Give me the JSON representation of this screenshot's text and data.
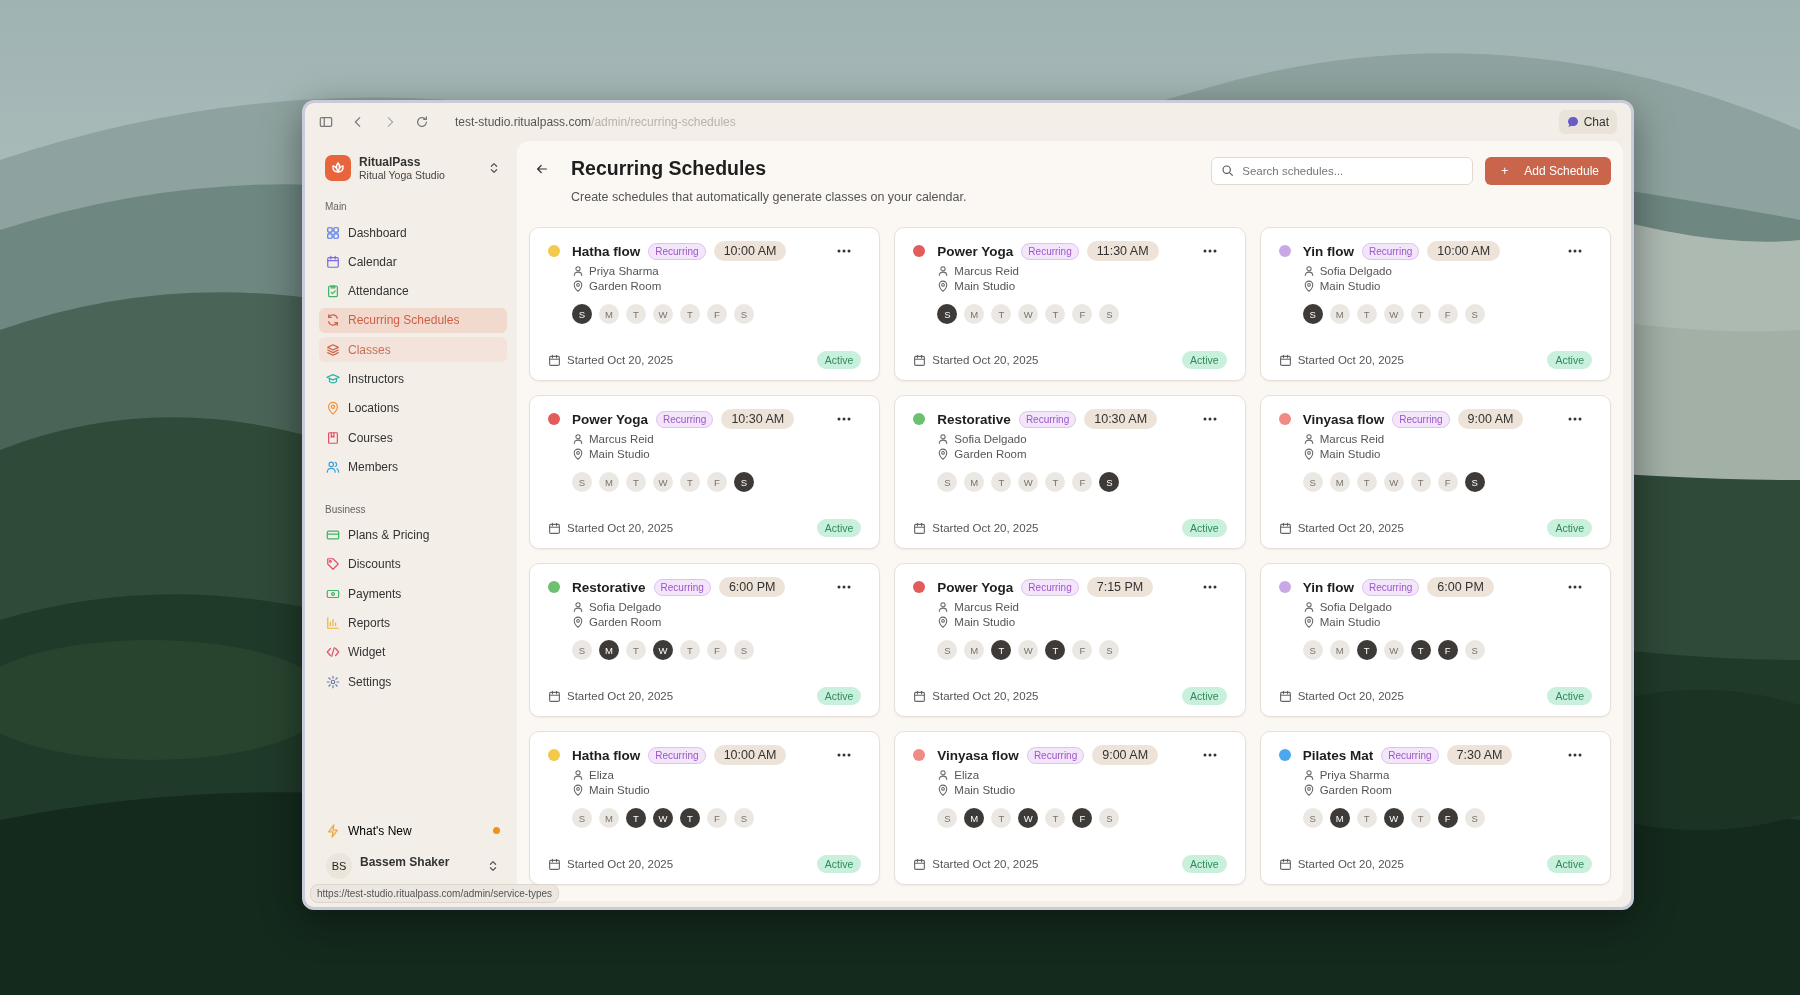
{
  "browser": {
    "url_host": "test-studio.ritualpass.com",
    "url_path": "/admin/recurring-schedules",
    "chat": "Chat",
    "status_url": "https://test-studio.ritualpass.com/admin/service-types"
  },
  "sidebar": {
    "brand": "RitualPass",
    "studio": "Ritual Yoga Studio",
    "sections": [
      {
        "title": "Main",
        "items": [
          {
            "label": "Dashboard",
            "selected": false,
            "highlighted": false
          },
          {
            "label": "Calendar",
            "selected": false,
            "highlighted": false
          },
          {
            "label": "Attendance",
            "selected": false,
            "highlighted": false
          },
          {
            "label": "Recurring Schedules",
            "selected": true,
            "highlighted": false
          },
          {
            "label": "Classes",
            "selected": false,
            "highlighted": true
          },
          {
            "label": "Instructors",
            "selected": false,
            "highlighted": false
          },
          {
            "label": "Locations",
            "selected": false,
            "highlighted": false
          },
          {
            "label": "Courses",
            "selected": false,
            "highlighted": false
          },
          {
            "label": "Members",
            "selected": false,
            "highlighted": false
          }
        ]
      },
      {
        "title": "Business",
        "items": [
          {
            "label": "Plans & Pricing",
            "selected": false,
            "highlighted": false
          },
          {
            "label": "Discounts",
            "selected": false,
            "highlighted": false
          },
          {
            "label": "Payments",
            "selected": false,
            "highlighted": false
          },
          {
            "label": "Reports",
            "selected": false,
            "highlighted": false
          },
          {
            "label": "Widget",
            "selected": false,
            "highlighted": false
          },
          {
            "label": "Settings",
            "selected": false,
            "highlighted": false
          }
        ]
      }
    ],
    "whats_new": {
      "label": "What's New",
      "unread": true
    },
    "user": {
      "initials": "BS",
      "name": "Bassem Shaker"
    }
  },
  "page": {
    "title": "Recurring Schedules",
    "subtitle": "Create schedules that automatically generate classes on your calendar.",
    "search": {
      "placeholder": "Search schedules..."
    },
    "add_button": "+",
    "add_label": "Add Schedule"
  },
  "schedules": [
    {
      "title": "Hatha flow",
      "color": "#f2c94c",
      "badge": "Recurring",
      "time": "10:00 AM",
      "instructor": "Priya Sharma",
      "location": "Garden Room",
      "days": [
        {
          "label": "S",
          "selected": true
        },
        {
          "label": "M",
          "selected": false
        },
        {
          "label": "T",
          "selected": false
        },
        {
          "label": "W",
          "selected": false
        },
        {
          "label": "T",
          "selected": false
        },
        {
          "label": "F",
          "selected": false
        },
        {
          "label": "S",
          "selected": false
        }
      ],
      "started": "Started Oct 20, 2025",
      "status": "Active"
    },
    {
      "title": "Power Yoga",
      "color": "#e25c5c",
      "badge": "Recurring",
      "time": "11:30 AM",
      "instructor": "Marcus Reid",
      "location": "Main Studio",
      "days": [
        {
          "label": "S",
          "selected": true
        },
        {
          "label": "M",
          "selected": false
        },
        {
          "label": "T",
          "selected": false
        },
        {
          "label": "W",
          "selected": false
        },
        {
          "label": "T",
          "selected": false
        },
        {
          "label": "F",
          "selected": false
        },
        {
          "label": "S",
          "selected": false
        }
      ],
      "started": "Started Oct 20, 2025",
      "status": "Active"
    },
    {
      "title": "Yin flow",
      "color": "#c9a8e3",
      "badge": "Recurring",
      "time": "10:00 AM",
      "instructor": "Sofia Delgado",
      "location": "Main Studio",
      "days": [
        {
          "label": "S",
          "selected": true
        },
        {
          "label": "M",
          "selected": false
        },
        {
          "label": "T",
          "selected": false
        },
        {
          "label": "W",
          "selected": false
        },
        {
          "label": "T",
          "selected": false
        },
        {
          "label": "F",
          "selected": false
        },
        {
          "label": "S",
          "selected": false
        }
      ],
      "started": "Started Oct 20, 2025",
      "status": "Active"
    },
    {
      "title": "Power Yoga",
      "color": "#e25c5c",
      "badge": "Recurring",
      "time": "10:30 AM",
      "instructor": "Marcus Reid",
      "location": "Main Studio",
      "days": [
        {
          "label": "S",
          "selected": false
        },
        {
          "label": "M",
          "selected": false
        },
        {
          "label": "T",
          "selected": false
        },
        {
          "label": "W",
          "selected": false
        },
        {
          "label": "T",
          "selected": false
        },
        {
          "label": "F",
          "selected": false
        },
        {
          "label": "S",
          "selected": true
        }
      ],
      "started": "Started Oct 20, 2025",
      "status": "Active"
    },
    {
      "title": "Restorative",
      "color": "#6cc070",
      "badge": "Recurring",
      "time": "10:30 AM",
      "instructor": "Sofia Delgado",
      "location": "Garden Room",
      "days": [
        {
          "label": "S",
          "selected": false
        },
        {
          "label": "M",
          "selected": false
        },
        {
          "label": "T",
          "selected": false
        },
        {
          "label": "W",
          "selected": false
        },
        {
          "label": "T",
          "selected": false
        },
        {
          "label": "F",
          "selected": false
        },
        {
          "label": "S",
          "selected": true
        }
      ],
      "started": "Started Oct 20, 2025",
      "status": "Active"
    },
    {
      "title": "Vinyasa flow",
      "color": "#f08a84",
      "badge": "Recurring",
      "time": "9:00 AM",
      "instructor": "Marcus Reid",
      "location": "Main Studio",
      "days": [
        {
          "label": "S",
          "selected": false
        },
        {
          "label": "M",
          "selected": false
        },
        {
          "label": "T",
          "selected": false
        },
        {
          "label": "W",
          "selected": false
        },
        {
          "label": "T",
          "selected": false
        },
        {
          "label": "F",
          "selected": false
        },
        {
          "label": "S",
          "selected": true
        }
      ],
      "started": "Started Oct 20, 2025",
      "status": "Active"
    },
    {
      "title": "Restorative",
      "color": "#6cc070",
      "badge": "Recurring",
      "time": "6:00 PM",
      "instructor": "Sofia Delgado",
      "location": "Garden Room",
      "days": [
        {
          "label": "S",
          "selected": false
        },
        {
          "label": "M",
          "selected": true
        },
        {
          "label": "T",
          "selected": false
        },
        {
          "label": "W",
          "selected": true
        },
        {
          "label": "T",
          "selected": false
        },
        {
          "label": "F",
          "selected": false
        },
        {
          "label": "S",
          "selected": false
        }
      ],
      "started": "Started Oct 20, 2025",
      "status": "Active"
    },
    {
      "title": "Power Yoga",
      "color": "#e25c5c",
      "badge": "Recurring",
      "time": "7:15 PM",
      "instructor": "Marcus Reid",
      "location": "Main Studio",
      "days": [
        {
          "label": "S",
          "selected": false
        },
        {
          "label": "M",
          "selected": false
        },
        {
          "label": "T",
          "selected": true
        },
        {
          "label": "W",
          "selected": false
        },
        {
          "label": "T",
          "selected": true
        },
        {
          "label": "F",
          "selected": false
        },
        {
          "label": "S",
          "selected": false
        }
      ],
      "started": "Started Oct 20, 2025",
      "status": "Active"
    },
    {
      "title": "Yin flow",
      "color": "#c9a8e3",
      "badge": "Recurring",
      "time": "6:00 PM",
      "instructor": "Sofia Delgado",
      "location": "Main Studio",
      "days": [
        {
          "label": "S",
          "selected": false
        },
        {
          "label": "M",
          "selected": false
        },
        {
          "label": "T",
          "selected": true
        },
        {
          "label": "W",
          "selected": false
        },
        {
          "label": "T",
          "selected": true
        },
        {
          "label": "F",
          "selected": true
        },
        {
          "label": "S",
          "selected": false
        }
      ],
      "started": "Started Oct 20, 2025",
      "status": "Active"
    },
    {
      "title": "Hatha flow",
      "color": "#f2c94c",
      "badge": "Recurring",
      "time": "10:00 AM",
      "instructor": "Eliza",
      "location": "Main Studio",
      "days": [
        {
          "label": "S",
          "selected": false
        },
        {
          "label": "M",
          "selected": false
        },
        {
          "label": "T",
          "selected": true
        },
        {
          "label": "W",
          "selected": true
        },
        {
          "label": "T",
          "selected": true
        },
        {
          "label": "F",
          "selected": false
        },
        {
          "label": "S",
          "selected": false
        }
      ],
      "started": "Started Oct 20, 2025",
      "status": "Active"
    },
    {
      "title": "Vinyasa flow",
      "color": "#f08a84",
      "badge": "Recurring",
      "time": "9:00 AM",
      "instructor": "Eliza",
      "location": "Main Studio",
      "days": [
        {
          "label": "S",
          "selected": false
        },
        {
          "label": "M",
          "selected": true
        },
        {
          "label": "T",
          "selected": false
        },
        {
          "label": "W",
          "selected": true
        },
        {
          "label": "T",
          "selected": false
        },
        {
          "label": "F",
          "selected": true
        },
        {
          "label": "S",
          "selected": false
        }
      ],
      "started": "Started Oct 20, 2025",
      "status": "Active"
    },
    {
      "title": "Pilates Mat",
      "color": "#4aa8f0",
      "badge": "Recurring",
      "time": "7:30 AM",
      "instructor": "Priya Sharma",
      "location": "Garden Room",
      "days": [
        {
          "label": "S",
          "selected": false
        },
        {
          "label": "M",
          "selected": true
        },
        {
          "label": "T",
          "selected": false
        },
        {
          "label": "W",
          "selected": true
        },
        {
          "label": "T",
          "selected": false
        },
        {
          "label": "F",
          "selected": true
        },
        {
          "label": "S",
          "selected": false
        }
      ],
      "started": "Started Oct 20, 2025",
      "status": "Active"
    }
  ]
}
